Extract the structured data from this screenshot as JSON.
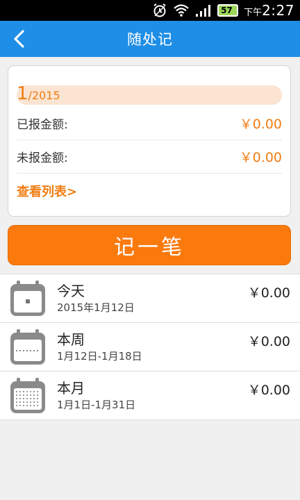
{
  "status_bar": {
    "battery": "57",
    "time_prefix": "下午",
    "time": "2:27"
  },
  "header": {
    "title": "随处记"
  },
  "summary": {
    "month": "1",
    "year": "/2015",
    "reported_label": "已报金额:",
    "reported_value": "￥0.00",
    "unreported_label": "未报金额:",
    "unreported_value": "￥0.00",
    "view_list": "查看列表>"
  },
  "record_button": "记一笔",
  "periods": [
    {
      "name": "今天",
      "range": "2015年1月12日",
      "amount": "￥0.00"
    },
    {
      "name": "本周",
      "range": "1月12日-1月18日",
      "amount": "￥0.00"
    },
    {
      "name": "本月",
      "range": "1月1日-1月31日",
      "amount": "￥0.00"
    }
  ],
  "colors": {
    "header": "#1f8ee6",
    "accent": "#f07d13",
    "button": "#fb7a0e"
  }
}
